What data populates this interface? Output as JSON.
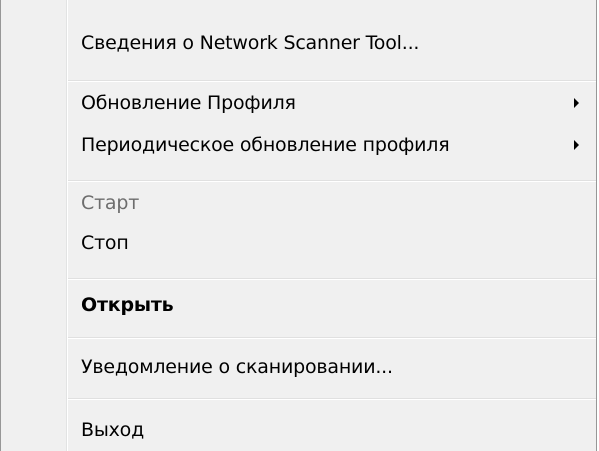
{
  "menu": {
    "items": [
      {
        "label": "Сведения о Network Scanner Tool..."
      },
      {
        "label": "Обновление Профиля",
        "submenu_icon": "chevron-right-icon"
      },
      {
        "label": "Периодическое обновление профиля",
        "submenu_icon": "chevron-right-icon"
      },
      {
        "label": "Старт",
        "state": "disabled"
      },
      {
        "label": "Стоп"
      },
      {
        "label": "Открыть",
        "state": "default-bold"
      },
      {
        "label": "Уведомление о сканировании..."
      },
      {
        "label": "Выход"
      }
    ]
  },
  "colors": {
    "menu_background": "#f0f0f0",
    "disabled_text": "#6d6d6d",
    "separator": "#e0e0e0",
    "border": "#979797"
  }
}
